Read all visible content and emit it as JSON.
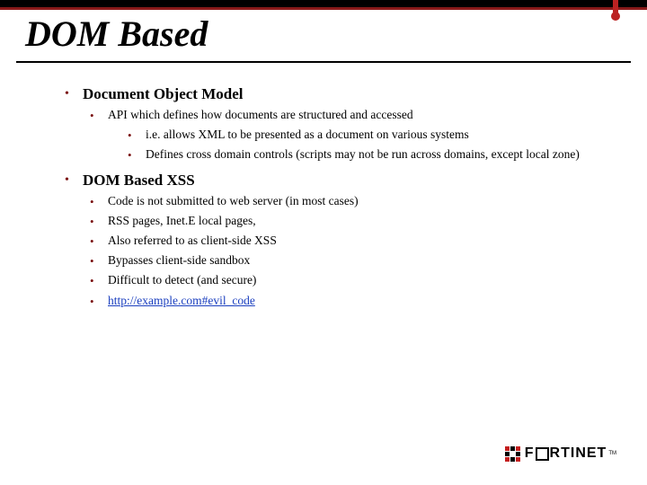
{
  "title": "DOM Based",
  "sections": [
    {
      "heading": "Document Object Model",
      "items": [
        {
          "text": "API which defines how documents are structured and accessed",
          "sub": [
            "i.e. allows XML to be presented as a document on various systems",
            "Defines cross domain controls (scripts may not be run across domains, except local zone)"
          ]
        }
      ]
    },
    {
      "heading": "DOM Based XSS",
      "items": [
        {
          "text": "Code is not submitted to web server (in most cases)"
        },
        {
          "text": "RSS pages, Inet.E local pages,"
        },
        {
          "text": "Also referred to as client-side XSS"
        },
        {
          "text": "Bypasses client-side sandbox"
        },
        {
          "text": "Difficult to detect (and secure)"
        },
        {
          "text": "http://example.com#evil_code",
          "link": true
        }
      ]
    }
  ],
  "footer": {
    "brand": "F   RTINET"
  }
}
